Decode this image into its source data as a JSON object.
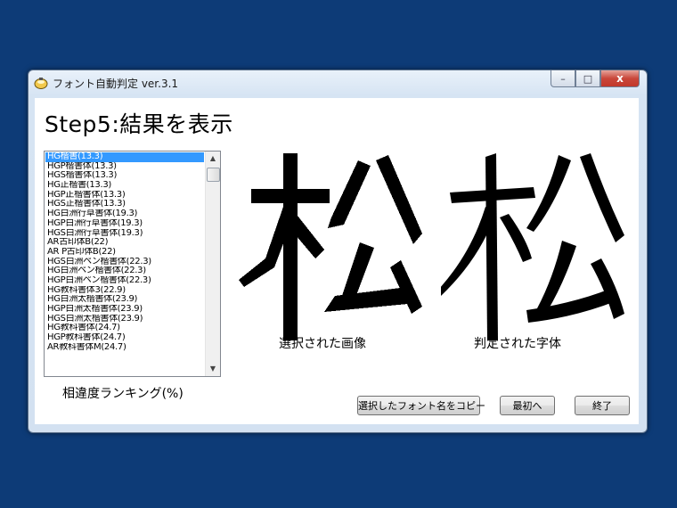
{
  "window": {
    "title": "フォント自動判定 ver.3.1",
    "controls": {
      "minimize": "–",
      "maximize": "□",
      "close": "x"
    }
  },
  "step_title": "Step5:結果を表示",
  "font_ranking": {
    "label": "相違度ランキング(%)",
    "items": [
      "HG楷書(13.3)",
      "HGP楷書体(13.3)",
      "HGS楷書体(13.3)",
      "HG正楷書(13.3)",
      "HGP正楷書体(13.3)",
      "HGS正楷書体(13.3)",
      "HG白洲行草書体(19.3)",
      "HGP白洲行草書体(19.3)",
      "HGS白洲行草書体(19.3)",
      "AR古印体B(22)",
      "AR P古印体B(22)",
      "HGS白洲ペン楷書体(22.3)",
      "HG白洲ペン楷書体(22.3)",
      "HGP白洲ペン楷書体(22.3)",
      "HG教科書体3(22.9)",
      "HG白洲太楷書体(23.9)",
      "HGP白洲太楷書体(23.9)",
      "HGS白洲太楷書体(23.9)",
      "HG教科書体(24.7)",
      "HGP教科書体(24.7)",
      "AR教科書体M(24.7)"
    ],
    "selected_index": 0
  },
  "preview": {
    "selected_image_caption": "選択された画像",
    "judged_font_caption": "判定された字体",
    "character": "松"
  },
  "buttons": {
    "copy_font_name": "選択したフォント名をコピー",
    "back_to_start": "最初へ",
    "exit": "終了"
  },
  "colors": {
    "desktop": "#0d3b77",
    "selection": "#3399ff",
    "close_button": "#c9473a"
  }
}
